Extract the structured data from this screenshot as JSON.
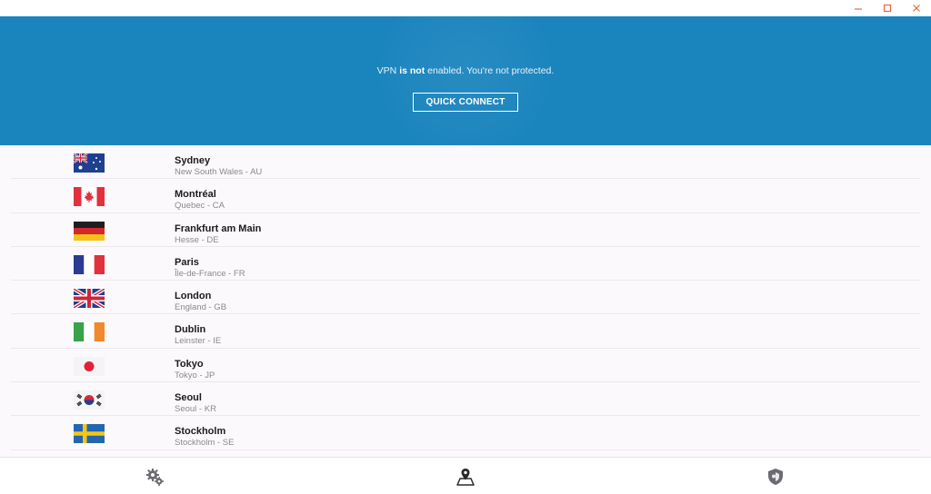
{
  "window": {
    "controls": [
      "minimize",
      "maximize",
      "close"
    ],
    "accent_color": "#e8693b"
  },
  "banner": {
    "status_prefix": "VPN ",
    "status_bold": "is not",
    "status_suffix": " enabled. You're not protected.",
    "quick_connect_label": "QUICK CONNECT",
    "background_color": "#1a84bd"
  },
  "locations": [
    {
      "city": "Sydney",
      "region": "New South Wales - AU",
      "flag": "au-flag"
    },
    {
      "city": "Montréal",
      "region": "Quebec - CA",
      "flag": "ca-flag"
    },
    {
      "city": "Frankfurt am Main",
      "region": "Hesse - DE",
      "flag": "de-flag"
    },
    {
      "city": "Paris",
      "region": "Île-de-France - FR",
      "flag": "fr-flag"
    },
    {
      "city": "London",
      "region": "England - GB",
      "flag": "gb-flag"
    },
    {
      "city": "Dublin",
      "region": "Leinster - IE",
      "flag": "ie-flag"
    },
    {
      "city": "Tokyo",
      "region": "Tokyo - JP",
      "flag": "jp-flag"
    },
    {
      "city": "Seoul",
      "region": "Seoul - KR",
      "flag": "kr-flag"
    },
    {
      "city": "Stockholm",
      "region": "Stockholm - SE",
      "flag": "se-flag"
    }
  ],
  "bottom_nav": {
    "items": [
      {
        "icon": "settings-gears-icon"
      },
      {
        "icon": "location-map-icon",
        "active": true
      },
      {
        "icon": "shield-icon"
      }
    ]
  }
}
